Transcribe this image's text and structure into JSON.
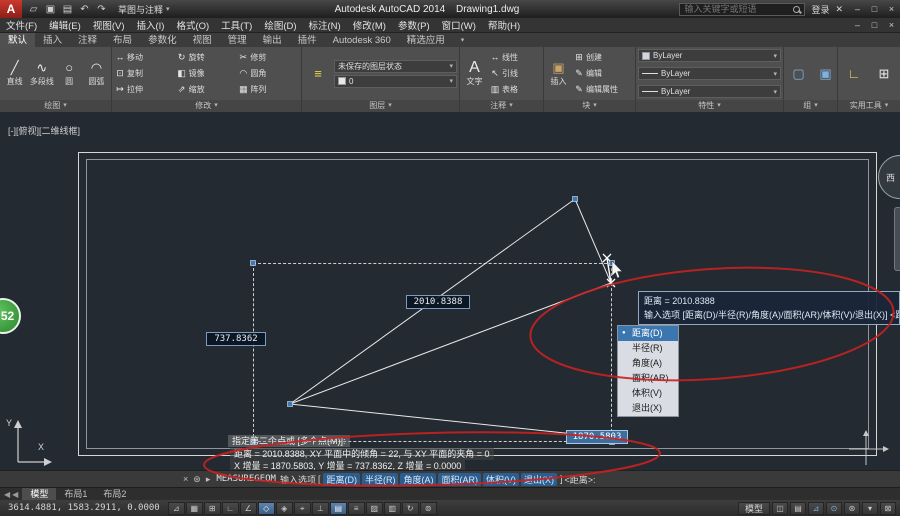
{
  "title_bar": {
    "app_title": "Autodesk AutoCAD 2014",
    "doc_title": "Drawing1.dwg",
    "workspace": "草图与注释",
    "search_placeholder": "输入关键字或短语",
    "sign_in_label": "登录"
  },
  "menu_items": [
    "文件(F)",
    "编辑(E)",
    "视图(V)",
    "插入(I)",
    "格式(O)",
    "工具(T)",
    "绘图(D)",
    "标注(N)",
    "修改(M)",
    "参数(P)",
    "窗口(W)",
    "帮助(H)"
  ],
  "ribbon": {
    "tabs": [
      "默认",
      "插入",
      "注释",
      "布局",
      "参数化",
      "视图",
      "管理",
      "输出",
      "插件",
      "Autodesk 360",
      "精选应用"
    ],
    "draw_panel": {
      "label": "绘图",
      "tools": [
        "直线",
        "多段线",
        "圆",
        "圆弧"
      ]
    },
    "modify_panel": {
      "label": "修改",
      "tools": [
        "移动",
        "旋转",
        "修剪",
        "复制",
        "镜像",
        "圆角",
        "拉伸",
        "缩放",
        "阵列"
      ]
    },
    "layers_panel": {
      "label": "图层",
      "layer_state": "未保存的图层状态",
      "current_layer": "0"
    },
    "annotation_panel": {
      "label": "注释",
      "tools": [
        "文字",
        "线性",
        "引线",
        "表格"
      ]
    },
    "block_panel": {
      "label": "块",
      "tools": [
        "插入",
        "创建",
        "编辑",
        "编辑属性"
      ]
    },
    "properties_panel": {
      "label": "特性",
      "values": [
        "ByLayer",
        "ByLayer",
        "ByLayer"
      ]
    },
    "groups_panel": {
      "label": "组"
    },
    "utilities_panel": {
      "label": "实用工具"
    }
  },
  "canvas": {
    "viewport_label": "[-][俯视][二维线框]",
    "dim_distance": "2010.8388",
    "dim_y": "737.8362",
    "dim_x": "1870.5803",
    "ucs_y_label": "Y",
    "ucs_x_label": "X",
    "viewcube_west": "西",
    "badge": "52"
  },
  "tooltip": {
    "line1": "距离 = 2010.8388",
    "line2": "输入选项 [距离(D)/半径(R)/角度(A)/面积(AR)/体积(V)/退出(X)] <距离>:"
  },
  "option_menu": {
    "items": [
      "距离(D)",
      "半径(R)",
      "角度(A)",
      "面积(AR)",
      "体积(V)",
      "退出(X)"
    ]
  },
  "command": {
    "history": [
      "指定第二个点或 [多个点(M)]:",
      "距离 = 2010.8388, XY 平面中的倾角 = 22, 与 XY 平面的夹角 = 0",
      "X 增量 = 1870.5803, Y 增量 = 737.8362, Z 增量 = 0.0000"
    ],
    "command_name": "MEASUREGEOM",
    "prompt_text": "输入选项",
    "options_open": "[",
    "options": [
      "距离(D)",
      "半径(R)",
      "角度(A)",
      "面积(AR)",
      "体积(V)",
      "退出(X)"
    ],
    "options_close": "]",
    "default_option": "<距离>:"
  },
  "layout_tabs": [
    "模型",
    "布局1",
    "布局2"
  ],
  "status_bar": {
    "coordinates": "3614.4881, 1583.2911, 0.0000",
    "toggles": [
      {
        "name": "infer-constraints",
        "glyph": "⊿"
      },
      {
        "name": "snap-mode",
        "glyph": "▦"
      },
      {
        "name": "grid-display",
        "glyph": "⊞"
      },
      {
        "name": "ortho-mode",
        "glyph": "∟"
      },
      {
        "name": "polar-tracking",
        "glyph": "∠"
      },
      {
        "name": "object-snap",
        "glyph": "◇"
      },
      {
        "name": "3d-object-snap",
        "glyph": "◈"
      },
      {
        "name": "object-snap-tracking",
        "glyph": "⌖"
      },
      {
        "name": "dynamic-ucs",
        "glyph": "⊥"
      },
      {
        "name": "dynamic-input",
        "glyph": "▤"
      },
      {
        "name": "lineweight",
        "glyph": "≡"
      },
      {
        "name": "transparency",
        "glyph": "▨"
      },
      {
        "name": "quick-properties",
        "glyph": "▥"
      },
      {
        "name": "selection-cycling",
        "glyph": "↻"
      },
      {
        "name": "annotation-monitor",
        "glyph": "⊚"
      }
    ],
    "right": {
      "model_label": "模型",
      "icons": [
        {
          "name": "quick-view-layouts-icon",
          "glyph": "◫"
        },
        {
          "name": "quick-view-drawings-icon",
          "glyph": "▤"
        },
        {
          "name": "annotation-scale-icon",
          "glyph": "⊿"
        },
        {
          "name": "annotation-visibility-icon",
          "glyph": "⊙"
        },
        {
          "name": "workspace-gear-icon",
          "glyph": "⊛"
        },
        {
          "name": "status-menu-caret-icon",
          "glyph": "▾"
        },
        {
          "name": "clean-screen-icon",
          "glyph": "⊠"
        }
      ]
    }
  },
  "icons": {
    "logo": "A",
    "open_folder": "▱",
    "save_disk": "▣",
    "plot": "▤",
    "undo": "↶",
    "redo": "↷",
    "caret": "▾",
    "minimize": "–",
    "maximize": "□",
    "close": "×",
    "exchange": "✕",
    "line": "╱",
    "polyline": "∿",
    "circle": "○",
    "arc": "◠",
    "move": "↔",
    "rotate": "↻",
    "trim": "✂",
    "copy": "⊡",
    "mirror": "◧",
    "fillet": "◠",
    "stretch": "↦",
    "scale": "⇗",
    "array": "▦",
    "layer_properties": "≡",
    "text_tool": "A",
    "linear_dim": "↔",
    "leader": "↖",
    "table": "▥",
    "insert_block": "▣",
    "create_block": "⊞",
    "edit_block": "✎",
    "edit_attr": "✎",
    "group": "▢",
    "ungroup": "▣",
    "measure": "∟",
    "quick_calc": "⊞",
    "wrench": "⊛",
    "prompt_caret": "▸",
    "tab_scroll": "◀"
  },
  "colors": {
    "accent_blue": "#3b76b0",
    "annotation_red": "#c92121",
    "canvas_bg": "#232a31",
    "selection_blue": "#3d6f9e"
  }
}
